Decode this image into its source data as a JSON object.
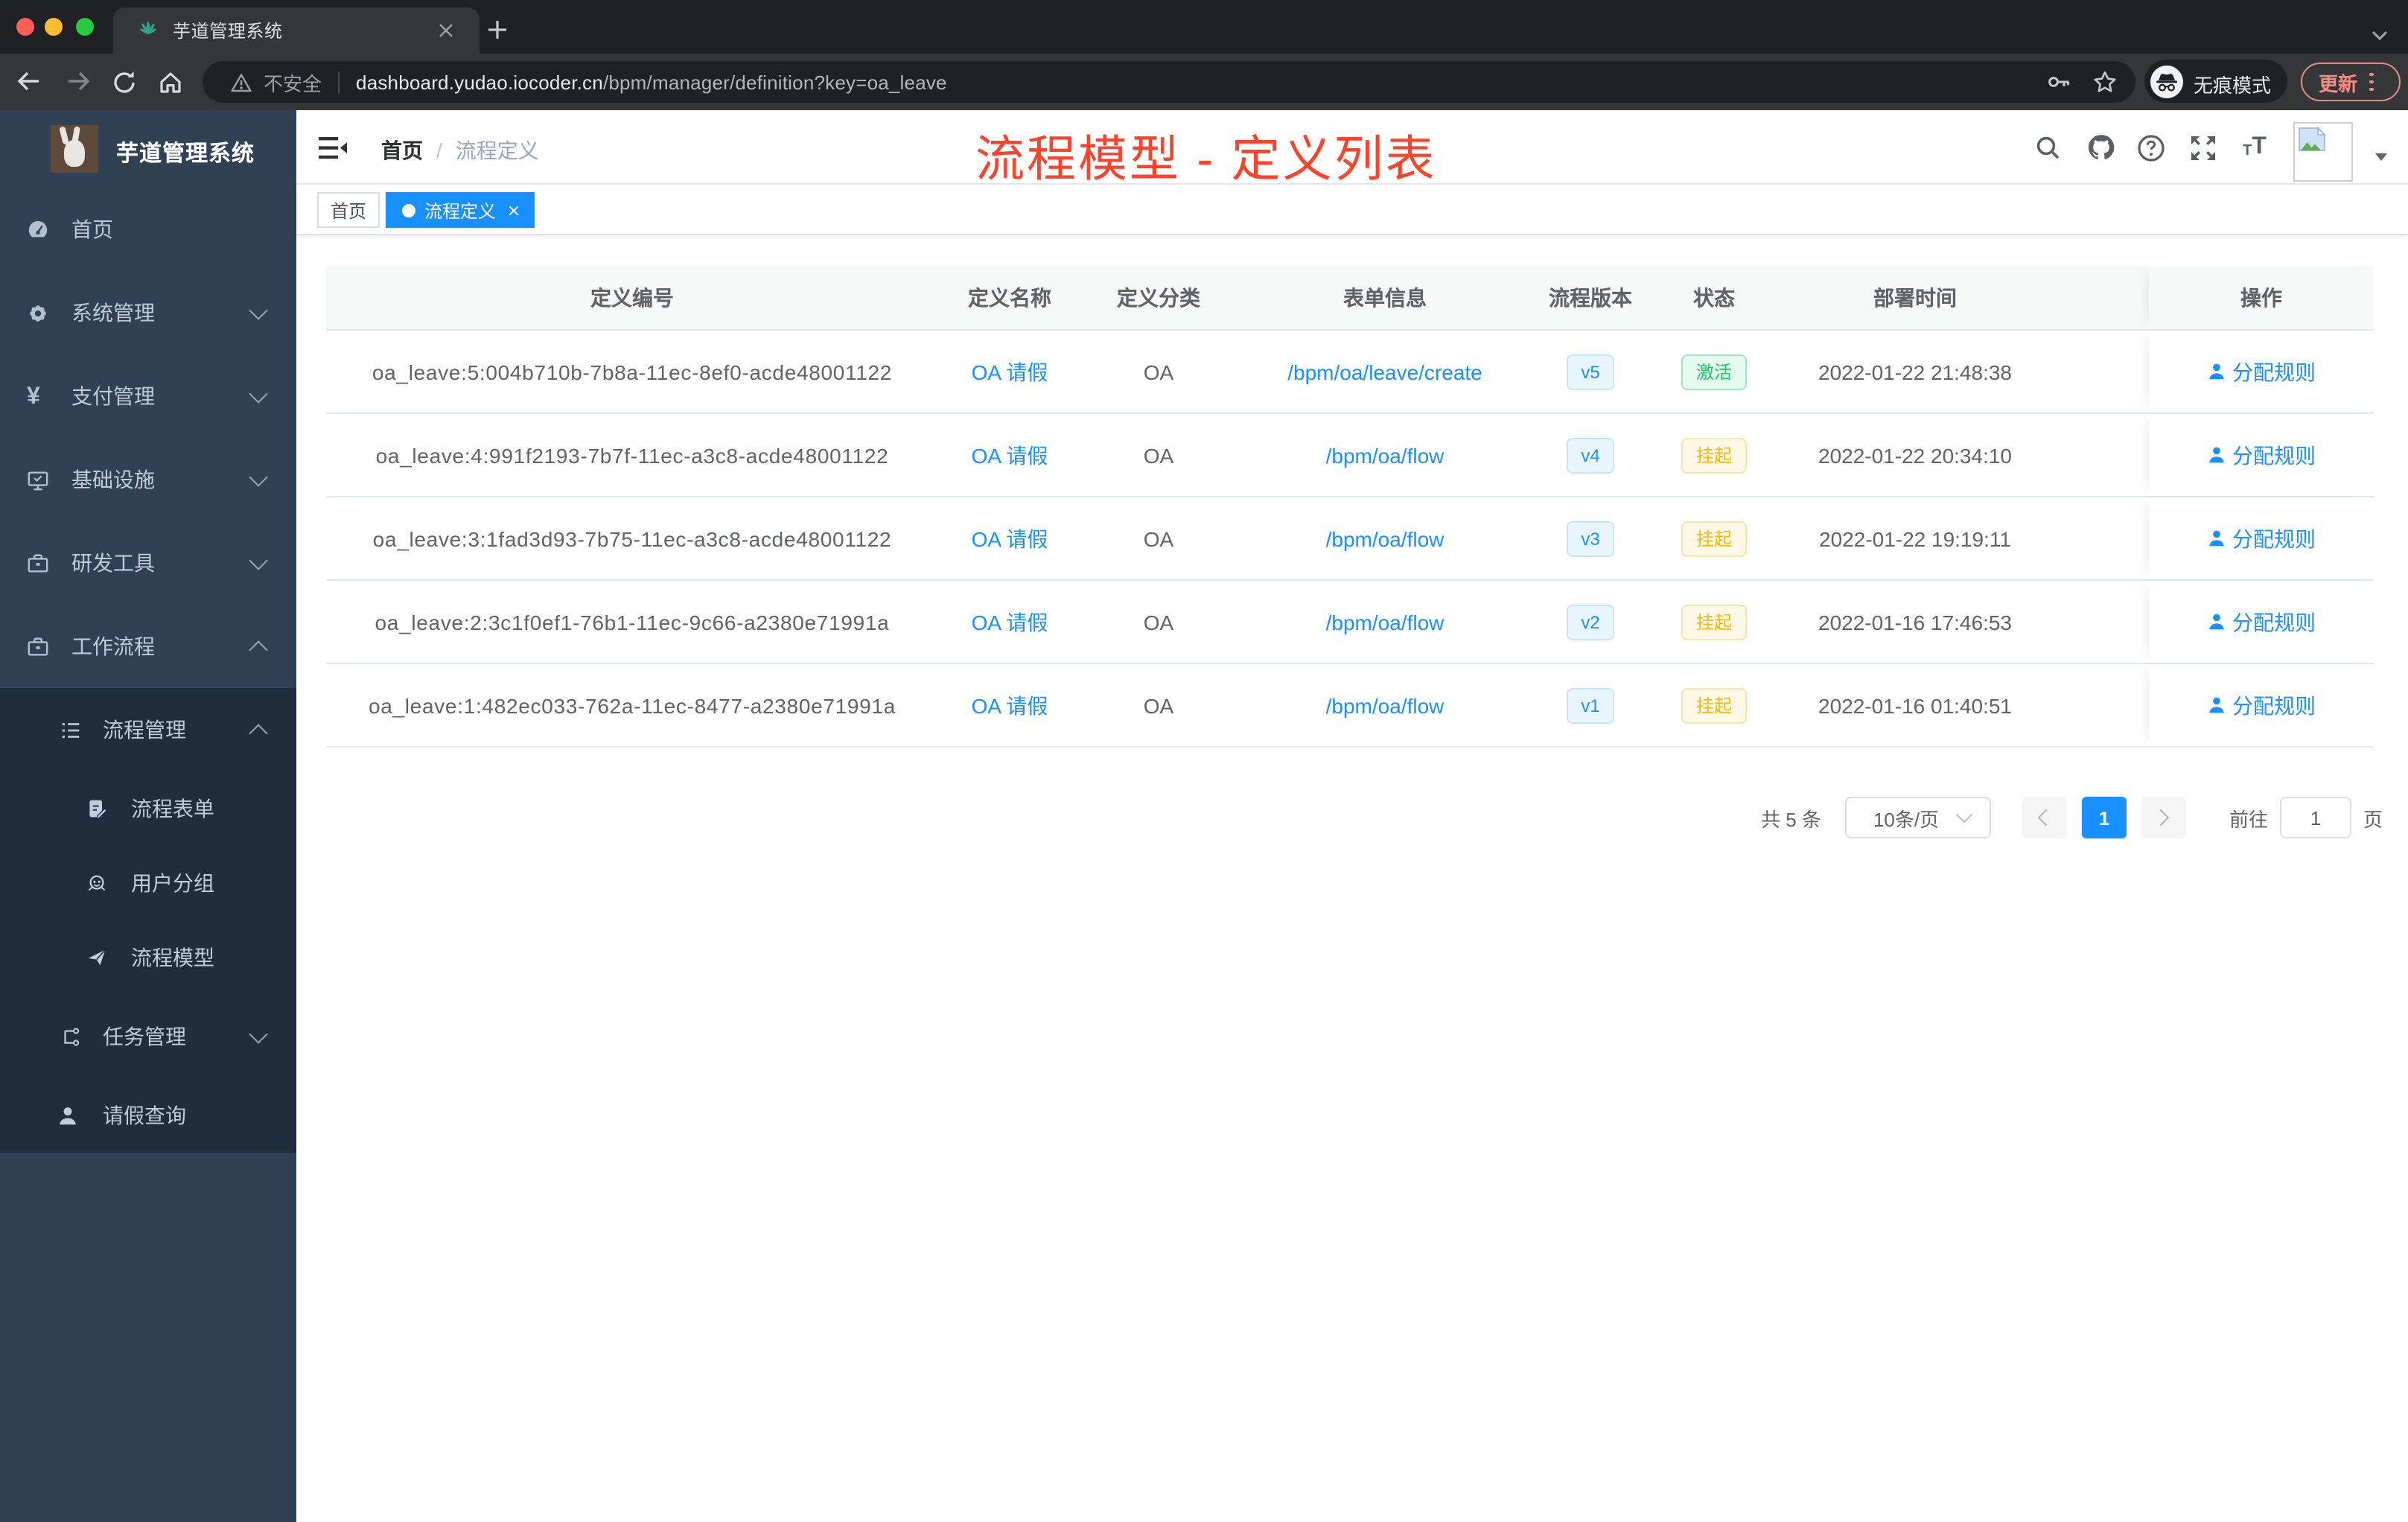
{
  "browser": {
    "tab_title": "芋道管理系统",
    "security_label": "不安全",
    "url_domain": "dashboard.yudao.iocoder.cn",
    "url_path": "/bpm/manager/definition?key=oa_leave",
    "incognito_label": "无痕模式",
    "update_label": "更新"
  },
  "sidebar": {
    "logo_title": "芋道管理系统",
    "items": [
      {
        "label": "首页",
        "icon": "dashboard-icon"
      },
      {
        "label": "系统管理",
        "icon": "gear-icon"
      },
      {
        "label": "支付管理",
        "icon": "yen-icon"
      },
      {
        "label": "基础设施",
        "icon": "monitor-icon"
      },
      {
        "label": "研发工具",
        "icon": "briefcase-icon"
      },
      {
        "label": "工作流程",
        "icon": "briefcase-icon",
        "expanded": true
      },
      {
        "label": "流程管理",
        "icon": "list-icon",
        "expanded": true
      },
      {
        "label": "流程表单",
        "icon": "form-icon"
      },
      {
        "label": "用户分组",
        "icon": "group-icon"
      },
      {
        "label": "流程模型",
        "icon": "plane-icon"
      },
      {
        "label": "任务管理",
        "icon": "tree-icon"
      },
      {
        "label": "请假查询",
        "icon": "person-icon"
      }
    ]
  },
  "navbar": {
    "breadcrumb": [
      "首页",
      "流程定义"
    ],
    "overlay_title": "流程模型 - 定义列表"
  },
  "tags": [
    {
      "label": "首页",
      "active": false
    },
    {
      "label": "流程定义",
      "active": true
    }
  ],
  "table": {
    "columns": [
      "定义编号",
      "定义名称",
      "定义分类",
      "表单信息",
      "流程版本",
      "状态",
      "部署时间",
      "操作"
    ],
    "action_label": "分配规则",
    "rows": [
      {
        "id": "oa_leave:5:004b710b-7b8a-11ec-8ef0-acde48001122",
        "name": "OA 请假",
        "category": "OA",
        "form": "/bpm/oa/leave/create",
        "version": "v5",
        "status": "激活",
        "status_type": "active",
        "time": "2022-01-22 21:48:38"
      },
      {
        "id": "oa_leave:4:991f2193-7b7f-11ec-a3c8-acde48001122",
        "name": "OA 请假",
        "category": "OA",
        "form": "/bpm/oa/flow",
        "version": "v4",
        "status": "挂起",
        "status_type": "suspended",
        "time": "2022-01-22 20:34:10"
      },
      {
        "id": "oa_leave:3:1fad3d93-7b75-11ec-a3c8-acde48001122",
        "name": "OA 请假",
        "category": "OA",
        "form": "/bpm/oa/flow",
        "version": "v3",
        "status": "挂起",
        "status_type": "suspended",
        "time": "2022-01-22 19:19:11"
      },
      {
        "id": "oa_leave:2:3c1f0ef1-76b1-11ec-9c66-a2380e71991a",
        "name": "OA 请假",
        "category": "OA",
        "form": "/bpm/oa/flow",
        "version": "v2",
        "status": "挂起",
        "status_type": "suspended",
        "time": "2022-01-16 17:46:53"
      },
      {
        "id": "oa_leave:1:482ec033-762a-11ec-8477-a2380e71991a",
        "name": "OA 请假",
        "category": "OA",
        "form": "/bpm/oa/flow",
        "version": "v1",
        "status": "挂起",
        "status_type": "suspended",
        "time": "2022-01-16 01:40:51"
      }
    ]
  },
  "pagination": {
    "total": "共 5 条",
    "page_size": "10条/页",
    "current_page": "1",
    "goto_label": "前往",
    "page_unit": "页"
  }
}
